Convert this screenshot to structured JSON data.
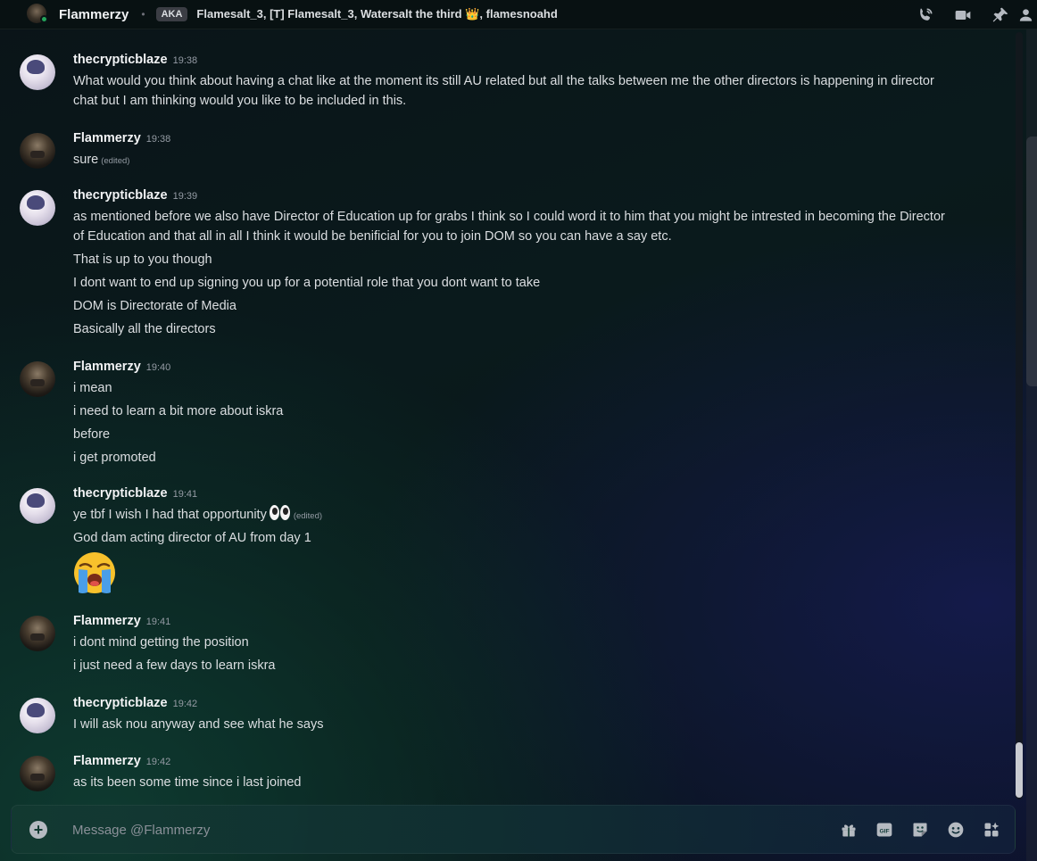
{
  "header": {
    "user_name": "Flammerzy",
    "separator": "•",
    "aka_label": "AKA",
    "aka_names": "Flamesalt_3, [T] Flamesalt_3, Watersalt the third",
    "aka_names_tail": ", flamesnoahd",
    "crown_emoji": "👑",
    "icons": [
      "voice-call-icon",
      "video-call-icon",
      "pin-icon",
      "member-list-icon"
    ]
  },
  "messages": [
    {
      "author": "thecrypticblaze",
      "time": "19:38",
      "avatar": "thecrypticblaze-avatar",
      "lines": [
        "What would you think about having a chat like at the moment its still AU related but all the talks between me the other directors is happening in director chat but I am thinking would you like to be included in this."
      ]
    },
    {
      "author": "Flammerzy",
      "time": "19:38",
      "avatar": "flammerzy-avatar",
      "lines": [
        "sure"
      ],
      "edited_label": "(edited)"
    },
    {
      "author": "thecrypticblaze",
      "time": "19:39",
      "avatar": "thecrypticblaze-avatar",
      "lines": [
        "as mentioned before we also have Director of Education up for grabs I think so I could word it to him that you might be intrested in becoming the Director of Education and that all in all I think it would be benificial for you to join DOM so you can have a say etc.",
        "That is up to you though",
        "I dont want to end up signing you up for a potential role that you dont want to take",
        "DOM is Directorate of Media",
        "Basically all the directors"
      ]
    },
    {
      "author": "Flammerzy",
      "time": "19:40",
      "avatar": "flammerzy-avatar",
      "lines": [
        "i mean",
        "i need to learn a bit more about iskra",
        "before",
        "i get promoted"
      ]
    },
    {
      "author": "thecrypticblaze",
      "time": "19:41",
      "avatar": "thecrypticblaze-avatar",
      "lines": [
        "ye tbf I wish I had that opportunity",
        "God dam acting director of AU from day 1"
      ],
      "edited_label": "(edited)",
      "big_emoji": "loudly-crying-face"
    },
    {
      "author": "Flammerzy",
      "time": "19:41",
      "avatar": "flammerzy-avatar",
      "lines": [
        "i dont mind getting the position",
        "i just need a few days to learn iskra"
      ]
    },
    {
      "author": "thecrypticblaze",
      "time": "19:42",
      "avatar": "thecrypticblaze-avatar",
      "lines": [
        "I will ask nou anyway and see what he says"
      ]
    },
    {
      "author": "Flammerzy",
      "time": "19:42",
      "avatar": "flammerzy-avatar",
      "lines": [
        "as its been some time since i last joined"
      ]
    }
  ],
  "composer": {
    "placeholder": "Message @Flammerzy",
    "icons": [
      "gift-icon",
      "gif-icon",
      "sticker-icon",
      "emoji-icon",
      "apps-icon"
    ],
    "gif_label": "GIF"
  }
}
